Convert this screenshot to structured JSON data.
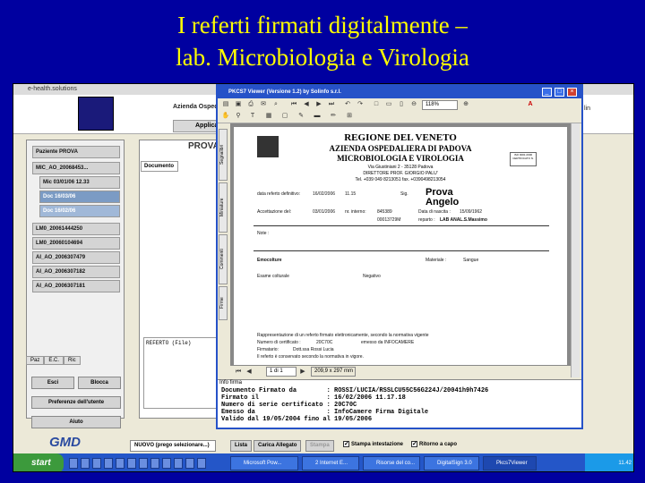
{
  "slide": {
    "title_line1": "I referti firmati digitalmente –",
    "title_line2": "lab. Microbiologia e Virologia"
  },
  "app": {
    "window_title": "e-health.solutions",
    "header_text": "Azienda Ospeda",
    "header_button": "Applicaz",
    "header_right": "lin",
    "content_title": "PROVA",
    "document_tab": "Documento",
    "referto_label": "REFERTO (File)"
  },
  "sidebar": {
    "patient": "Paziente PROVA",
    "items": [
      {
        "label": "MIC_AO_20068453..."
      },
      {
        "label": "Mic 03/01/06 12.33"
      },
      {
        "label": "Doc 16/03/06"
      },
      {
        "label": "Doc 16/02/06"
      },
      {
        "label": "LM0_20061444250"
      },
      {
        "label": "LM0_20060104694"
      },
      {
        "label": "AI_AO_2006307479"
      },
      {
        "label": "AI_AO_2006307182"
      },
      {
        "label": "AI_AO_2006307181"
      }
    ],
    "tabs": [
      "Paz",
      "E.C.",
      "Ric"
    ],
    "btn_esci": "Esci",
    "btn_blocca": "Blocca",
    "btn_pref": "Preferenze dell'utente",
    "btn_aiuto": "Aiuto",
    "logo": "GMD"
  },
  "bottom_bar": {
    "select_value": "NUOVO (prego selezionare...)",
    "lista": "Lista",
    "carica": "Carica Allegato",
    "stampa": "Stampa",
    "stampa_intest": "Stampa intestazione",
    "ritorno": "Ritorno a capo"
  },
  "taskbar": {
    "start": "start",
    "buttons": [
      "Microsoft Pow...",
      "2 Internet E...",
      "Risorse del co...",
      "DigitalSign 3.0",
      "Pkcs7Viewer"
    ],
    "clock": "11.42"
  },
  "pdf": {
    "title": "PKCS7 Viewer (Versione 1.2) by Solinfo s.r.l.",
    "zoom": "118%",
    "side_tabs": [
      "Segnalibri",
      "Miniature",
      "Commenti",
      "Firme"
    ],
    "page_indicator": "1 di 1",
    "page_size": "209,9 x 297 mm",
    "doc": {
      "region": "REGIONE DEL VENETO",
      "azienda": "AZIENDA OSPEDALIERA DI PADOVA",
      "lab": "MICROBIOLOGIA E VIROLOGIA",
      "address": "Via Giustiniani 2 - 35128 Padova",
      "director": "DIRETTORE PROF. GIORGIO PALU'",
      "tel": "Tel. +039 049 8213051   fax. +0390498213054",
      "iso": "ISO 9001:2000 CERTIFICATO N.",
      "data_def_label": "data referto definitivo:",
      "data_def": "16/02/2006",
      "ora": "11.15",
      "sig_label": "Sig.",
      "sig_name1": "Prova",
      "sig_name2": "Angelo",
      "accett_label": "Accettazione del:",
      "accett_date": "03/01/2006",
      "interno_label": "nr. interno:",
      "interno": "845389",
      "nascita_label": "Data di nascita :",
      "nascita": "15/09/1962",
      "code": "00013729M",
      "reparto_label": "reparto :",
      "reparto": "LAB ANAL.S.Massimo",
      "note": "Note :",
      "emocolture": "Emocolture",
      "materiale_label": "Materiale :",
      "materiale": "Sangue",
      "esame": "Esame colturale",
      "esito": "Negativo",
      "rapp1": "Rappresentazione di un referto firmato elettronicamente, secondo la normativa vigente",
      "cert_label": "Numero di certificato :",
      "cert": "20C70C",
      "emesso": "emesso da INFOCAMERE",
      "firmatario_label": "Firmatario:",
      "firmatario": "Dott.ssa Rossi Lucia",
      "conservato": "Il referto è conservato secondo la normativa in vigore."
    },
    "info": {
      "title": "Info firma",
      "rows": [
        "Documento Firmato da        : ROSSI/LUCIA/RSSLCU55C56G224J/20041h9h7426",
        "Firmato il                  : 16/02/2006 11.17.18",
        "Numero di serie certificato : 20C70C",
        "Emesso da                   : InfoCamere Firma Digitale",
        "Valido dal 19/05/2004 fino al 19/05/2006"
      ]
    }
  }
}
